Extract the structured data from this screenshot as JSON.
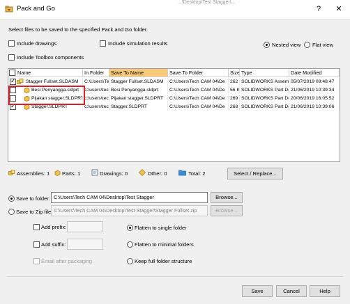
{
  "window": {
    "title": "Pack and Go",
    "help_label": "?",
    "close_label": "✕",
    "bg_path_text": "...\\Desktop\\Test Stagger\\..."
  },
  "instruction": "Select files to be saved to the specified Pack and Go folder.",
  "options": {
    "include_drawings": "Include drawings",
    "include_simulation": "Include simulation results",
    "include_toolbox": "Include Toolbox components",
    "nested_view": "Nested view",
    "flat_view": "Flat view",
    "view_selected": "nested"
  },
  "table": {
    "headers": [
      "Name",
      "In Folder",
      "Save To Name",
      "Save To Folder",
      "Size",
      "Type",
      "Date Modified"
    ],
    "rows": [
      {
        "checked": true,
        "name": "Stagger Fullset.SLDASM",
        "in_folder": "C:\\Users\\Te",
        "save_to_name": "Stagger Fullset.SLDASM",
        "save_to_folder": "C:\\Users\\Tech CAM 04\\De",
        "size": "262",
        "type": "SOLIDWORKS Assemb",
        "date": "05/07/2019 09:48:47"
      },
      {
        "checked": false,
        "name": "Besi Penyangga.sldprt",
        "in_folder": "c:\\users\\tec",
        "save_to_name": "Besi Penyangga.sldprt",
        "save_to_folder": "C:\\Users\\Tech CAM 04\\De",
        "size": "56 K",
        "type": "SOLIDWORKS Part Do",
        "date": "21/06/2019 10:39:34"
      },
      {
        "checked": false,
        "name": "Pijakan stagger.SLDPRT",
        "in_folder": "c:\\users\\tec",
        "save_to_name": "Pijakan stagger.SLDPRT",
        "save_to_folder": "C:\\Users\\Tech CAM 04\\De",
        "size": "269",
        "type": "SOLIDWORKS Part Do",
        "date": "20/06/2019 16:05:52"
      },
      {
        "checked": true,
        "name": "Stagger.SLDPRT",
        "in_folder": "c:\\users\\tec",
        "save_to_name": "Stagger.SLDPRT",
        "save_to_folder": "C:\\Users\\Tech CAM 04\\De",
        "size": "268",
        "type": "SOLIDWORKS Part Do",
        "date": "21/06/2019 10:39:06"
      }
    ]
  },
  "summary": {
    "assemblies": "Assemblies: 1",
    "parts": "Parts: 1",
    "drawings": "Drawings: 0",
    "other": "Other: 0",
    "total": "Total: 2",
    "select_replace": "Select / Replace..."
  },
  "save": {
    "to_folder_label": "Save to folder:",
    "folder_path": "C:\\Users\\Tech CAM 04\\Desktop\\Test Stagger",
    "browse_label": "Browse...",
    "to_zip_label": "Save to Zip file:",
    "zip_path": "C:\\Users\\Tech CAM 04\\Desktop\\Test Stagger\\Stagger Fullset.zip",
    "browse2_label": "Browse...",
    "selected": "folder"
  },
  "naming": {
    "add_prefix": "Add prefix:",
    "add_suffix": "Add suffix:",
    "email": "Email after packaging"
  },
  "structure": {
    "flatten_single": "Flatten to single folder",
    "flatten_minimal": "Flatten to minimal folders",
    "keep_full": "Keep full folder structure",
    "selected": "flatten_single"
  },
  "buttons": {
    "save": "Save",
    "cancel": "Cancel",
    "help": "Help"
  },
  "colors": {
    "highlight": "#fbc97a",
    "annotation_red": "#d9202a"
  }
}
